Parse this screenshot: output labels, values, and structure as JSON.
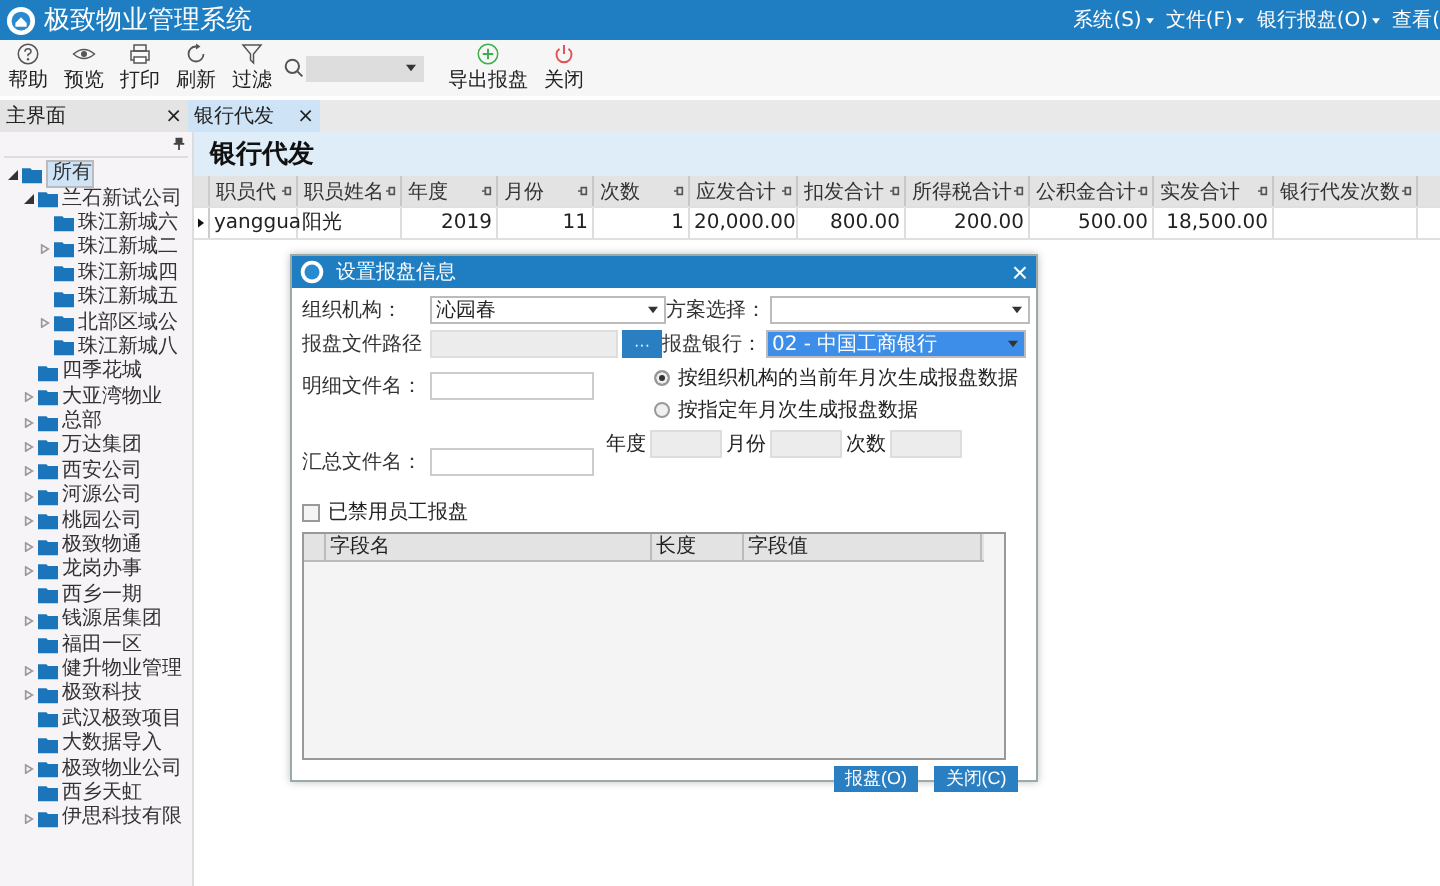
{
  "window": {
    "title": "极致物业管理系统"
  },
  "menu": [
    "系统(S)",
    "文件(F)",
    "银行报盘(O)",
    "查看("
  ],
  "toolbar": [
    {
      "label": "帮助",
      "kind": "help"
    },
    {
      "label": "预览",
      "kind": "eye"
    },
    {
      "label": "打印",
      "kind": "print"
    },
    {
      "label": "刷新",
      "kind": "refresh"
    },
    {
      "label": "过滤",
      "kind": "filter"
    },
    {
      "kind": "search"
    },
    {
      "label": "导出报盘",
      "kind": "add"
    },
    {
      "label": "关闭",
      "kind": "power"
    }
  ],
  "tabs": [
    {
      "label": "主界面",
      "close": "×",
      "selected": false
    },
    {
      "label": "银行代发",
      "close": "×",
      "selected": true
    }
  ],
  "tree": [
    {
      "label": "所有",
      "kind": "branch",
      "expanded": true,
      "selected": true,
      "children": [
        {
          "label": "兰石新试公司",
          "kind": "branch",
          "expanded": true,
          "selected": false,
          "children": [
            {
              "label": "珠江新城六",
              "kind": "leaf",
              "selected": false
            },
            {
              "label": "珠江新城二",
              "kind": "branch",
              "expanded": false,
              "selected": false
            },
            {
              "label": "珠江新城四",
              "kind": "leaf",
              "selected": false
            },
            {
              "label": "珠江新城五",
              "kind": "leaf",
              "selected": false
            },
            {
              "label": "北部区域公",
              "kind": "branch",
              "expanded": false,
              "selected": false
            },
            {
              "label": "珠江新城八",
              "kind": "leaf",
              "selected": false
            }
          ]
        },
        {
          "label": "四季花城",
          "kind": "leaf",
          "selected": false
        },
        {
          "label": "大亚湾物业",
          "kind": "branch",
          "expanded": false,
          "selected": false
        },
        {
          "label": "总部",
          "kind": "branch",
          "expanded": false,
          "selected": false
        },
        {
          "label": "万达集团",
          "kind": "branch",
          "expanded": false,
          "selected": false
        },
        {
          "label": "西安公司",
          "kind": "branch",
          "expanded": false,
          "selected": false
        },
        {
          "label": "河源公司",
          "kind": "branch",
          "expanded": false,
          "selected": false
        },
        {
          "label": "桃园公司",
          "kind": "branch",
          "expanded": false,
          "selected": false
        },
        {
          "label": "极致物通",
          "kind": "branch",
          "expanded": false,
          "selected": false
        },
        {
          "label": "龙岗办事",
          "kind": "branch",
          "expanded": false,
          "selected": false
        },
        {
          "label": "西乡一期",
          "kind": "leaf",
          "selected": false
        },
        {
          "label": "钱源居集团",
          "kind": "branch",
          "expanded": false,
          "selected": false
        },
        {
          "label": "福田一区",
          "kind": "leaf",
          "selected": false
        },
        {
          "label": "健升物业管理",
          "kind": "branch",
          "expanded": false,
          "selected": false
        },
        {
          "label": "极致科技",
          "kind": "branch",
          "expanded": false,
          "selected": false
        },
        {
          "label": "武汉极致项目",
          "kind": "leaf",
          "selected": false
        },
        {
          "label": "大数据导入",
          "kind": "leaf",
          "selected": false
        },
        {
          "label": "极致物业公司",
          "kind": "branch",
          "expanded": false,
          "selected": false
        },
        {
          "label": "西乡天虹",
          "kind": "leaf",
          "selected": false
        },
        {
          "label": "伊思科技有限",
          "kind": "branch",
          "expanded": false,
          "selected": false
        }
      ]
    }
  ],
  "page_title": "银行代发",
  "table": {
    "columns": [
      {
        "label": "职员代",
        "kind": "text"
      },
      {
        "label": "职员姓名",
        "kind": "text"
      },
      {
        "label": "年度",
        "kind": "number"
      },
      {
        "label": "月份",
        "kind": "number"
      },
      {
        "label": "次数",
        "kind": "number"
      },
      {
        "label": "应发合计",
        "kind": "number"
      },
      {
        "label": "扣发合计",
        "kind": "number"
      },
      {
        "label": "所得税合计",
        "kind": "number"
      },
      {
        "label": "公积金合计",
        "kind": "number"
      },
      {
        "label": "实发合计",
        "kind": "number"
      },
      {
        "label": "银行代发次数",
        "kind": "number"
      }
    ],
    "rows": [
      {
        "current": true,
        "cells": [
          "yanggua",
          "阳光",
          "2019",
          "11",
          "1",
          "20,000.00",
          "800.00",
          "200.00",
          "500.00",
          "18,500.00",
          ""
        ]
      }
    ]
  },
  "dialog": {
    "title": "设置报盘信息",
    "close": "×",
    "org": {
      "label": "组织机构：",
      "value": "沁园春"
    },
    "scheme": {
      "label": "方案选择："
    },
    "path": {
      "label": "报盘文件路径",
      "button": "···",
      "disabled": true
    },
    "bank": {
      "label": "报盘银行：",
      "value": "02 - 中国工商银行",
      "focused": true
    },
    "detail_file": {
      "label": "明细文件名："
    },
    "summary_file": {
      "label": "汇总文件名："
    },
    "radios": [
      {
        "label": "按组织机构的当前年月次生成报盘数据",
        "selected": true
      },
      {
        "label": "按指定年月次生成报盘数据",
        "selected": false
      }
    ],
    "period": [
      {
        "label": "年度",
        "disabled": true
      },
      {
        "label": "月份",
        "disabled": true
      },
      {
        "label": "次数",
        "disabled": true
      }
    ],
    "checkbox": {
      "label": "已禁用员工报盘",
      "checked": false
    },
    "grid_columns": [
      "字段名",
      "长度",
      "字段值"
    ],
    "buttons": [
      "报盘(O)",
      "关闭(C)"
    ]
  }
}
